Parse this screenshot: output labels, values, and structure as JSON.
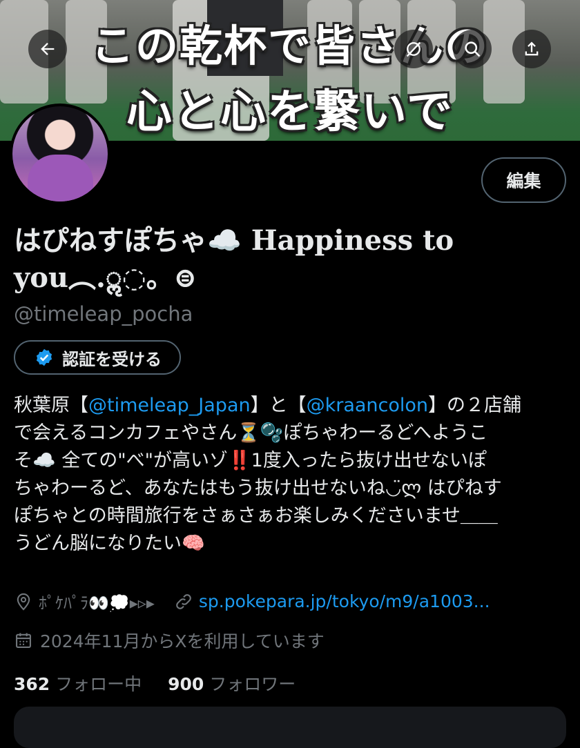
{
  "banner": {
    "caption_line1": "この乾杯で皆さんの",
    "caption_line2": "心と心を繋いで"
  },
  "header_icons": {
    "back": "arrow-left-icon",
    "grok": "grok-icon",
    "search": "search-icon",
    "share": "share-icon"
  },
  "profile": {
    "edit_label": "編集",
    "name_line1": "はぴねすぽちゃ☁️ Happiness to",
    "name_line2": "you︵.ॢ◌。⊜",
    "handle": "@timeleap_pocha",
    "verify_label": "認証を受ける"
  },
  "bio": {
    "line1_pre": "秋葉原【",
    "mention1": "@timeleap_Japan",
    "line1_mid": "】と【",
    "mention2": "@kraancolon",
    "line1_post": "】の２店舗",
    "line2": "で会えるコンカフェやさん⏳🫧ぽちゃわーるどへようこ",
    "line3": "そ☁️ 全ての\"べ\"が高いゾ‼️1度入ったら抜け出せないぽ",
    "line4": "ちゃわーるど、あなたはもう抜け出せないね◡̈ლ はぴねす",
    "line5": "ぽちゃとの時間旅行をさぁさぁお楽しみくださいませ＿＿",
    "line6": "うどん脳になりたい🧠"
  },
  "meta": {
    "location": "ﾎﾟｹﾊﾟﾗ👀💭▸▹▸",
    "url": "sp.pokepara.jp/tokyo/m9/a1003...",
    "joined": "2024年11月からXを利用しています"
  },
  "stats": {
    "following_count": "362",
    "following_label": "フォロー中",
    "followers_count": "900",
    "followers_label": "フォロワー"
  },
  "colors": {
    "accent": "#1d9bf0",
    "muted": "#71767b",
    "text": "#e7e9ea",
    "border": "#536471"
  }
}
